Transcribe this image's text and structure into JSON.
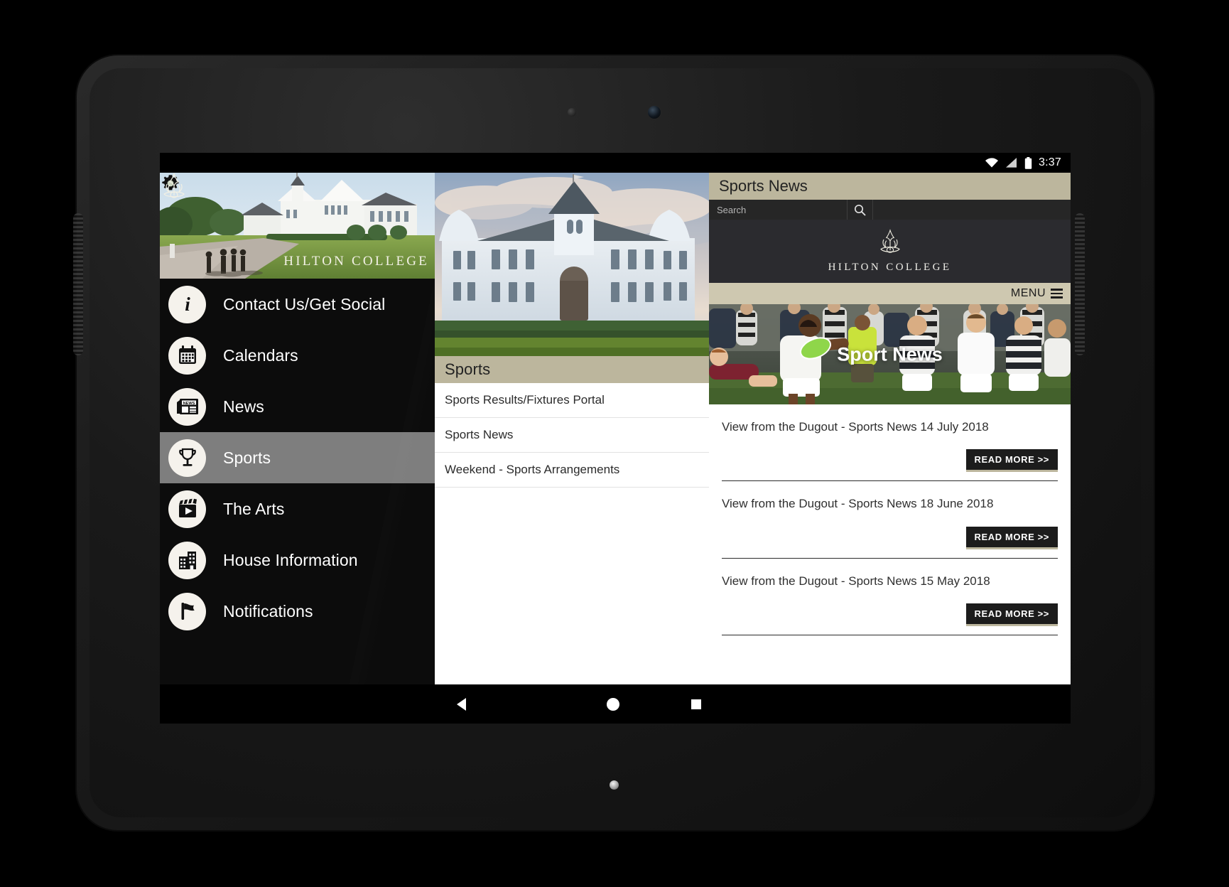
{
  "status_bar": {
    "time": "3:37",
    "icons": [
      "wifi-icon",
      "signal-icon",
      "battery-icon"
    ]
  },
  "left_nav": {
    "hero": {
      "wordmark": "HILTON COLLEGE",
      "settings_icon": "gear-icon",
      "crest_icon": "crest-icon"
    },
    "items": [
      {
        "label": "Contact Us/Get Social",
        "icon": "info-icon",
        "selected": false
      },
      {
        "label": "Calendars",
        "icon": "calendar-icon",
        "selected": false
      },
      {
        "label": "News",
        "icon": "newspaper-icon",
        "selected": false
      },
      {
        "label": "Sports",
        "icon": "trophy-icon",
        "selected": true
      },
      {
        "label": "The Arts",
        "icon": "clapperboard-play-icon",
        "selected": false
      },
      {
        "label": "House Information",
        "icon": "building-icon",
        "selected": false
      },
      {
        "label": "Notifications",
        "icon": "flag-icon",
        "selected": false
      }
    ]
  },
  "middle_pane": {
    "hero_image_alt": "hilton-college-building-photo",
    "section_title": "Sports",
    "items": [
      "Sports Results/Fixtures Portal",
      "Sports News",
      "Weekend - Sports Arrangements"
    ]
  },
  "right_pane": {
    "title": "Sports News",
    "search": {
      "placeholder": "Search",
      "value": "",
      "button_icon": "search-icon"
    },
    "site_logo": {
      "wordmark": "HILTON COLLEGE",
      "crest_icon": "crest-icon"
    },
    "menu": {
      "label": "MENU",
      "icon": "hamburger-icon"
    },
    "banner": {
      "title": "Sport News",
      "image_alt": "rugby-match-photo"
    },
    "articles": [
      {
        "title": "View from the Dugout - Sports News 14 July 2018",
        "button": "READ MORE >>"
      },
      {
        "title": "View from the Dugout - Sports News 18 June 2018",
        "button": "READ MORE >>"
      },
      {
        "title": "View from the Dugout - Sports News 15 May 2018",
        "button": "READ MORE >>"
      }
    ]
  },
  "android_nav": {
    "back": "back-button",
    "home": "home-button",
    "recents": "recents-button"
  },
  "colors": {
    "accent_tan": "#bcb69d",
    "menu_band": "#cec8b0",
    "dark_chrome": "#2b2b2f",
    "nav_selected": "#7e7e7e",
    "nav_background": "#0c0c0c"
  }
}
